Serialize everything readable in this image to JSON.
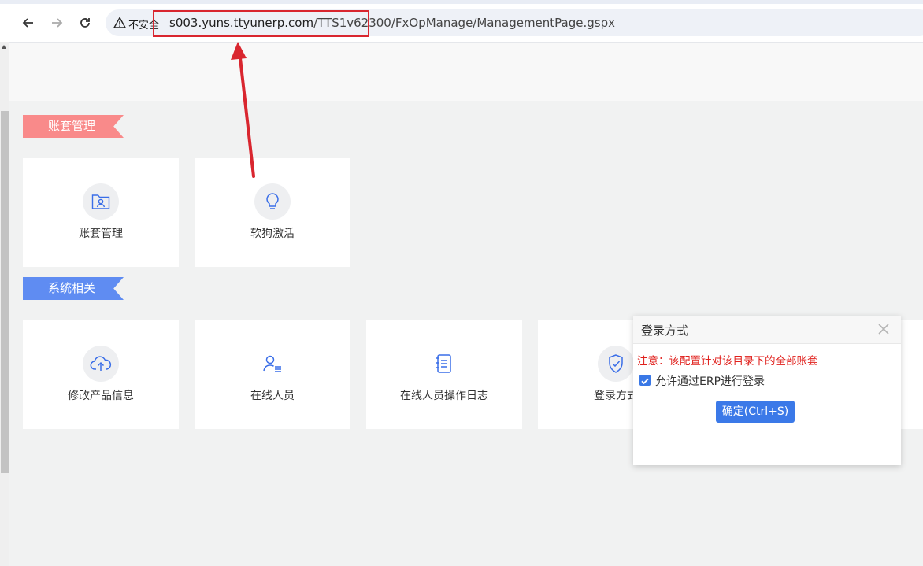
{
  "browser": {
    "insecure_label": "不安全",
    "url_host": "s003.yuns.ttyunerp.com",
    "url_path": "/TTS1v62300/FxOpManage/ManagementPage.gspx"
  },
  "sections": [
    {
      "title": "账套管理",
      "cards": [
        {
          "label": "账套管理",
          "icon": "folder-user-icon"
        },
        {
          "label": "软狗激活",
          "icon": "lightbulb-icon"
        }
      ]
    },
    {
      "title": "系统相关",
      "cards": [
        {
          "label": "修改产品信息",
          "icon": "cloud-upload-icon"
        },
        {
          "label": "在线人员",
          "icon": "user-list-icon"
        },
        {
          "label": "在线人员操作日志",
          "icon": "notebook-icon"
        },
        {
          "label": "登录方式",
          "icon": "shield-check-icon"
        }
      ]
    }
  ],
  "dialog": {
    "title": "登录方式",
    "note": "注意：该配置针对该目录下的全部账套",
    "checkbox_label": "允许通过ERP进行登录",
    "checkbox_checked": true,
    "confirm_label": "确定(Ctrl+S)"
  },
  "colors": {
    "ribbon_red": "#f98a8a",
    "ribbon_blue": "#5f8cf2",
    "accent": "#3b79e8",
    "annotation": "#d9262f"
  }
}
